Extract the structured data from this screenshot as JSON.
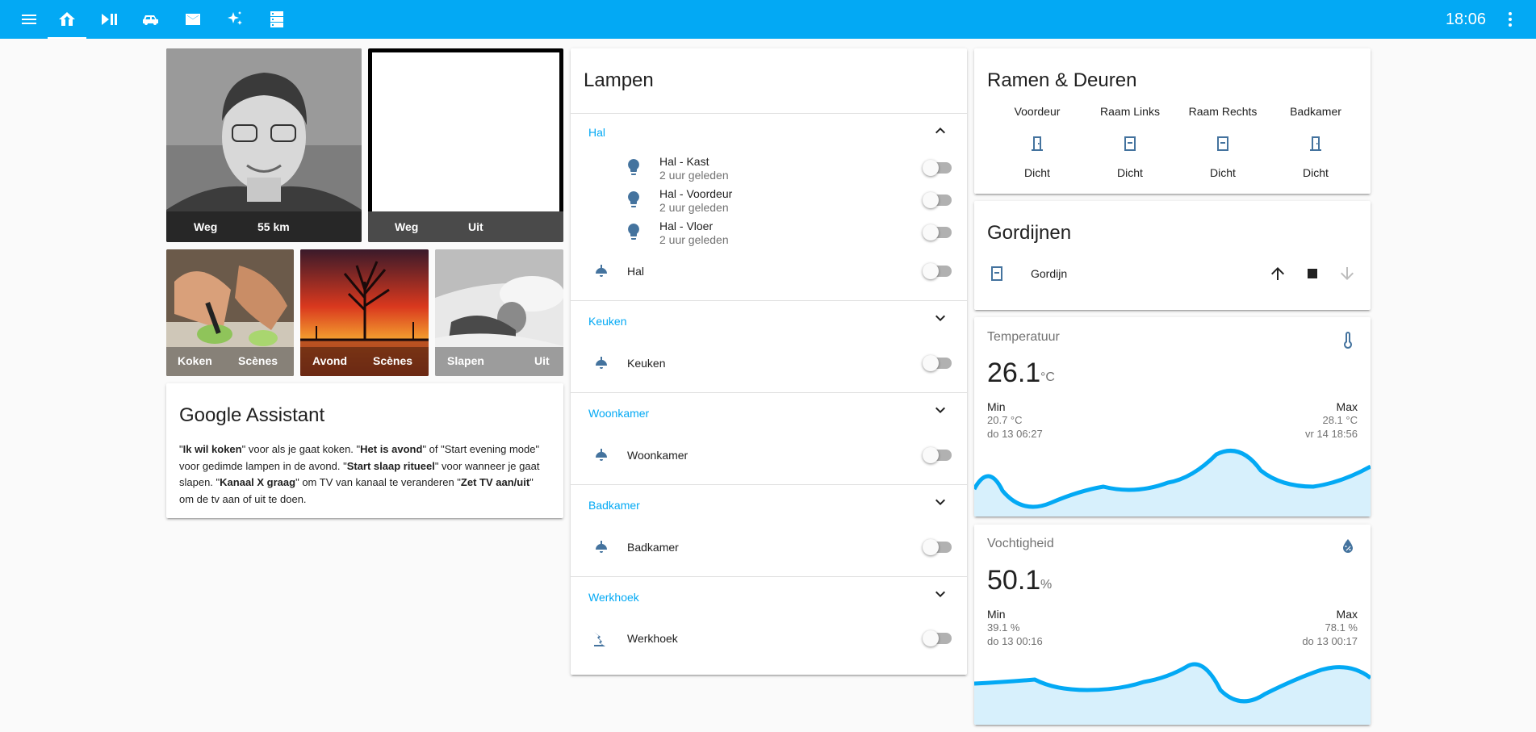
{
  "topbar": {
    "clock": "18:06",
    "icons": [
      "menu-icon",
      "home-icon",
      "play-pause-icon",
      "car-icon",
      "mail-icon",
      "sparkle-icon",
      "server-icon",
      "more-vert-icon"
    ]
  },
  "persons": [
    {
      "state": "Weg",
      "distance": "55 km"
    },
    {
      "state": "Weg",
      "distance": "Uit"
    }
  ],
  "scenes": [
    {
      "name": "Koken",
      "state": "Scènes"
    },
    {
      "name": "Avond",
      "state": "Scènes"
    },
    {
      "name": "Slapen",
      "state": "Uit"
    }
  ],
  "assistant": {
    "title": "Google Assistant",
    "p1": "\"",
    "b1": "Ik wil koken",
    "t1": "\" voor als je gaat koken. \"",
    "b2": "Het is avond",
    "t2": "\" of \"Start evening mode\" voor gedimde lampen in de avond. \"",
    "b3": "Start slaap ritueel",
    "t3": "\" voor wanneer je gaat slapen. \"",
    "b4": "Kanaal X graag",
    "t4": "\" om TV van kanaal te veranderen \"",
    "b5": "Zet TV aan/uit",
    "t5": "\" om de tv aan of uit te doen."
  },
  "lamps": {
    "title": "Lampen",
    "groups": [
      {
        "name": "Hal",
        "expanded": true,
        "children": [
          {
            "name": "Hal - Kast",
            "sub": "2 uur geleden"
          },
          {
            "name": "Hal - Voordeur",
            "sub": "2 uur geleden"
          },
          {
            "name": "Hal - Vloer",
            "sub": "2 uur geleden"
          }
        ],
        "row": "Hal"
      },
      {
        "name": "Keuken",
        "row": "Keuken"
      },
      {
        "name": "Woonkamer",
        "row": "Woonkamer"
      },
      {
        "name": "Badkamer",
        "row": "Badkamer"
      },
      {
        "name": "Werkhoek",
        "row": "Werkhoek"
      }
    ]
  },
  "doors": {
    "title": "Ramen & Deuren",
    "items": [
      {
        "name": "Voordeur",
        "state": "Dicht"
      },
      {
        "name": "Raam Links",
        "state": "Dicht"
      },
      {
        "name": "Raam Rechts",
        "state": "Dicht"
      },
      {
        "name": "Badkamer",
        "state": "Dicht"
      }
    ]
  },
  "curtains": {
    "title": "Gordijnen",
    "name": "Gordijn"
  },
  "temperature": {
    "name": "Temperatuur",
    "value": "26.1",
    "unit": "°C",
    "min_label": "Min",
    "min_value": "20.7 °C",
    "min_time": "do 13 06:27",
    "max_label": "Max",
    "max_value": "28.1 °C",
    "max_time": "vr 14 18:56"
  },
  "humidity": {
    "name": "Vochtigheid",
    "value": "50.1",
    "unit": "%",
    "min_label": "Min",
    "min_value": "39.1 %",
    "min_time": "do 13 00:16",
    "max_label": "Max",
    "max_value": "78.1 %",
    "max_time": "do 13 00:17"
  },
  "colors": {
    "accent": "#03a9f4",
    "icon": "#44739e",
    "graph_fill": "#d7f0fc"
  }
}
